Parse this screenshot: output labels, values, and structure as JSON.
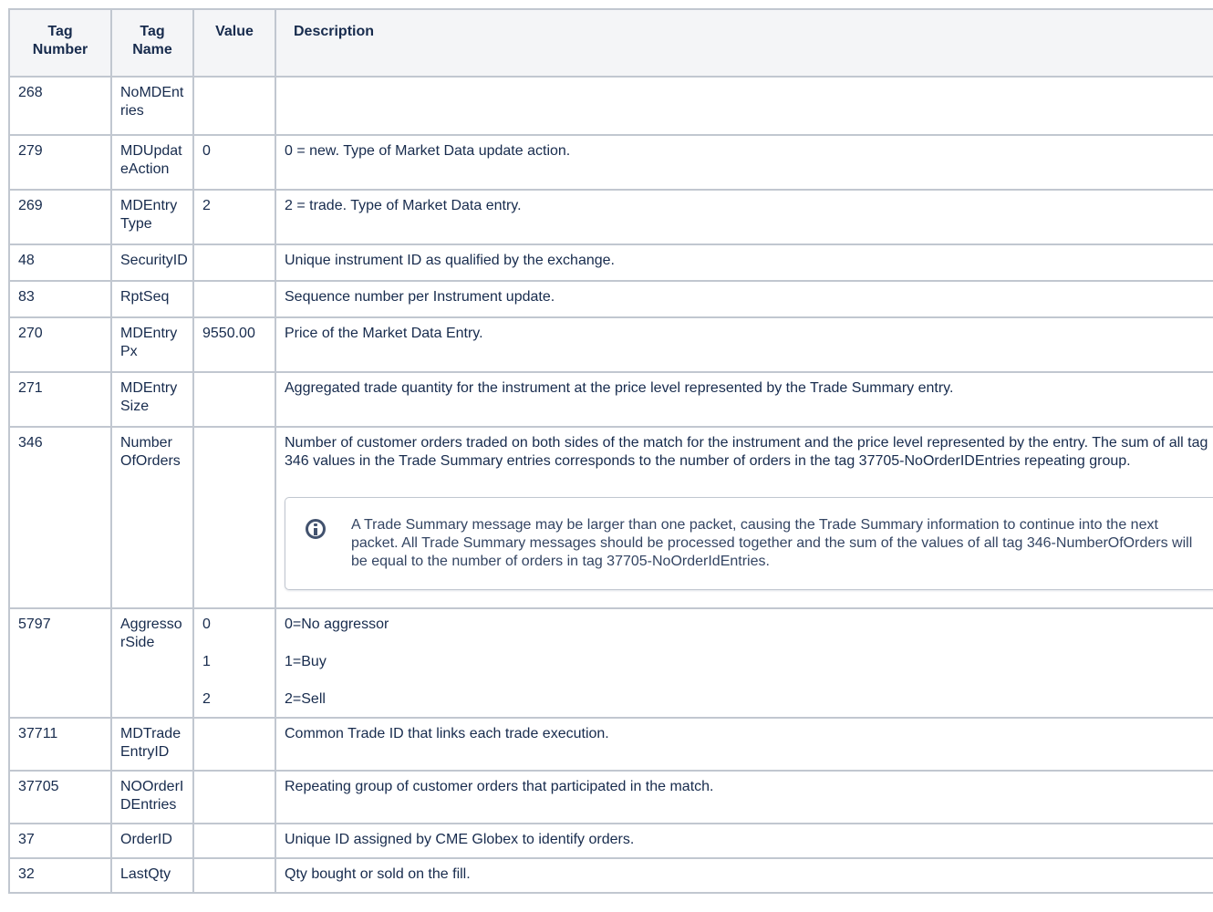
{
  "table": {
    "headers": {
      "tag_number": "Tag Number",
      "tag_name": "Tag Name",
      "value": "Value",
      "description": "Description"
    },
    "rows": [
      {
        "tag_number": "268",
        "tag_name": "NoMDEntries",
        "value": "",
        "description": ""
      },
      {
        "tag_number": "279",
        "tag_name": "MDUpdateAction",
        "value": "0",
        "description": "0 = new. Type of Market Data update action."
      },
      {
        "tag_number": "269",
        "tag_name": "MDEntryType",
        "value": "2",
        "description": "2 = trade. Type of Market Data entry."
      },
      {
        "tag_number": "48",
        "tag_name": "SecurityID",
        "value": "",
        "description": "Unique instrument ID as qualified by the exchange."
      },
      {
        "tag_number": "83",
        "tag_name": "RptSeq",
        "value": "",
        "description": "Sequence number per Instrument update."
      },
      {
        "tag_number": "270",
        "tag_name": "MDEntryPx",
        "value": "9550.00",
        "description": "Price of the Market Data Entry."
      },
      {
        "tag_number": "271",
        "tag_name": "MDEntrySize",
        "value": "",
        "description": "Aggregated trade quantity for the instrument at the price level represented by the Trade Summary entry."
      },
      {
        "tag_number": "346",
        "tag_name_line1": "Number",
        "tag_name_line2": "OfOrders",
        "value": "",
        "description": "Number of customer orders traded on both sides of the match for the instrument and the price level represented by the entry. The sum of all tag 346 values in the Trade Summary entries corresponds to the number of orders in the tag 37705-NoOrderIDEntries repeating group.",
        "info_note": "A Trade Summary message may be larger than one packet, causing the Trade Summary information to continue into the next packet. All Trade Summary messages should be processed together and the sum of the values of all tag 346-NumberOfOrders will be equal to the number of orders in tag 37705-NoOrderIdEntries."
      },
      {
        "tag_number": "5797",
        "tag_name": "AggressorSide",
        "values": [
          "0",
          "1",
          "2"
        ],
        "descriptions": [
          "0=No aggressor",
          "1=Buy",
          "2=Sell"
        ]
      },
      {
        "tag_number": "37711",
        "tag_name": "MDTradeEntryID",
        "value": "",
        "description": "Common Trade ID that links each trade execution."
      },
      {
        "tag_number": "37705",
        "tag_name": "NOOrderIDEntries",
        "value": "",
        "description": "Repeating group of customer orders that participated in the match."
      },
      {
        "tag_number": "37",
        "tag_name": "OrderID",
        "value": "",
        "description": "Unique ID assigned by CME Globex to identify orders."
      },
      {
        "tag_number": "32",
        "tag_name": "LastQty",
        "value": "",
        "description": "Qty bought or sold on the fill."
      }
    ]
  },
  "icons": {
    "info": "info-icon"
  },
  "colors": {
    "border": "#c1c7d0",
    "header_bg": "#f4f5f7",
    "text": "#172b4d"
  }
}
